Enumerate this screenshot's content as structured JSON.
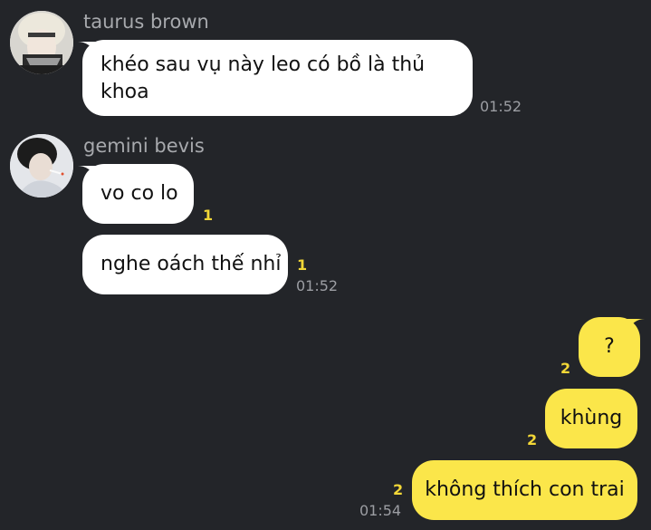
{
  "messages": [
    {
      "sender": "taurus brown",
      "text": "khéo sau vụ này leo có bồ là thủ khoa",
      "time": "01:52"
    },
    {
      "sender": "gemini bevis",
      "text": "vo co lo",
      "unread": "1"
    },
    {
      "sender": "gemini bevis",
      "text": "nghe oách thế nhỉ",
      "unread": "1",
      "time": "01:52"
    },
    {
      "sender": "me",
      "text": "?",
      "unread": "2"
    },
    {
      "sender": "me",
      "text": "khùng",
      "unread": "2"
    },
    {
      "sender": "me",
      "text": "không thích con trai",
      "unread": "2",
      "time": "01:54"
    }
  ],
  "colors": {
    "background": "#232529",
    "incoming_bubble": "#ffffff",
    "outgoing_bubble": "#fbe64a",
    "unread": "#f2d737"
  }
}
